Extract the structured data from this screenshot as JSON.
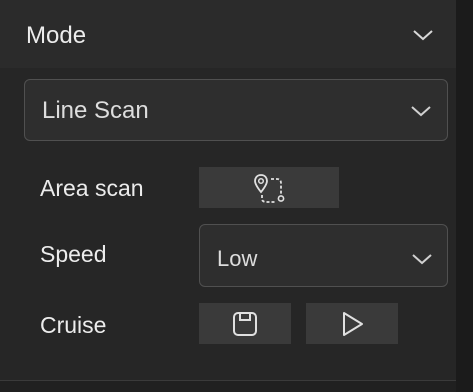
{
  "header": {
    "title": "Mode",
    "toggle_icon": "chevron-down-icon"
  },
  "mode_select": {
    "value": "Line Scan",
    "icon": "chevron-down-icon"
  },
  "area_scan": {
    "label": "Area scan",
    "icon": "route-path-icon"
  },
  "speed": {
    "label": "Speed",
    "value": "Low",
    "icon": "chevron-down-icon"
  },
  "cruise": {
    "label": "Cruise",
    "save_icon": "save-icon",
    "play_icon": "play-icon"
  },
  "colors": {
    "panel": "#262626",
    "header": "#2b2b2b",
    "button": "#3a3a3a",
    "border": "#505050",
    "text": "#ececec"
  }
}
